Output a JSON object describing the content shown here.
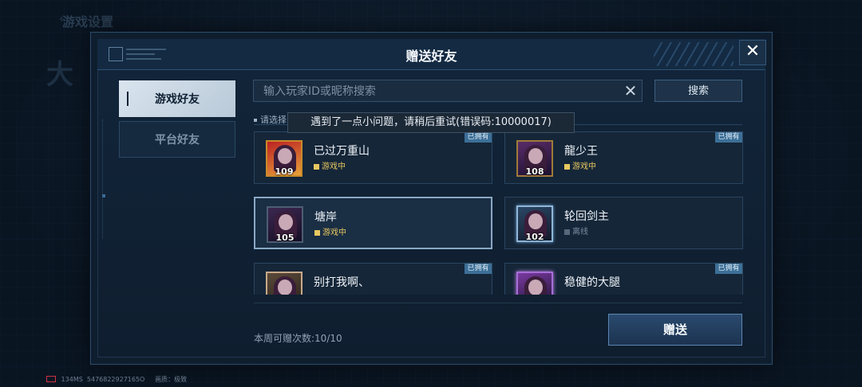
{
  "background": {
    "back_arrow": "‹",
    "title": "游戏设置",
    "big_text": "大"
  },
  "modal": {
    "title": "赠送好友",
    "close_label": "✕"
  },
  "tabs": [
    {
      "label": "游戏好友",
      "active": true
    },
    {
      "label": "平台好友",
      "active": false
    }
  ],
  "search": {
    "placeholder": "输入玩家ID或昵称搜索",
    "value": "",
    "clear_label": "✕",
    "button_label": "搜索"
  },
  "select_label": "请选择",
  "error_toast": "遇到了一点小问题，请稍后重试(错误码:10000017)",
  "friends": [
    {
      "name": "已过万重山",
      "level": "109",
      "status": "游戏中",
      "online": true,
      "owned_badge": "已拥有",
      "frame": "gold"
    },
    {
      "name": "龍少王",
      "level": "108",
      "status": "游戏中",
      "online": true,
      "owned_badge": "已拥有",
      "frame": "purple"
    },
    {
      "name": "塘岸",
      "level": "105",
      "status": "游戏中",
      "online": true,
      "owned_badge": "",
      "frame": "plain",
      "selected": true
    },
    {
      "name": "轮回剑主",
      "level": "102",
      "status": "离线",
      "online": false,
      "owned_badge": "",
      "frame": "crystal"
    },
    {
      "name": "别打我啊、",
      "level": "",
      "status": "",
      "online": false,
      "owned_badge": "已拥有",
      "frame": "arch"
    },
    {
      "name": "稳健的大腿",
      "level": "",
      "status": "",
      "online": false,
      "owned_badge": "已拥有",
      "frame": "neon"
    }
  ],
  "weekly_count": "本周可赠次数:10/10",
  "send_button": "赠送",
  "footer": {
    "ping": "134MS",
    "id": "5476822927165O",
    "quality": "画质：极致"
  },
  "colors": {
    "accent": "#3c6f97",
    "online": "#e8c860",
    "offline": "#56687c"
  }
}
